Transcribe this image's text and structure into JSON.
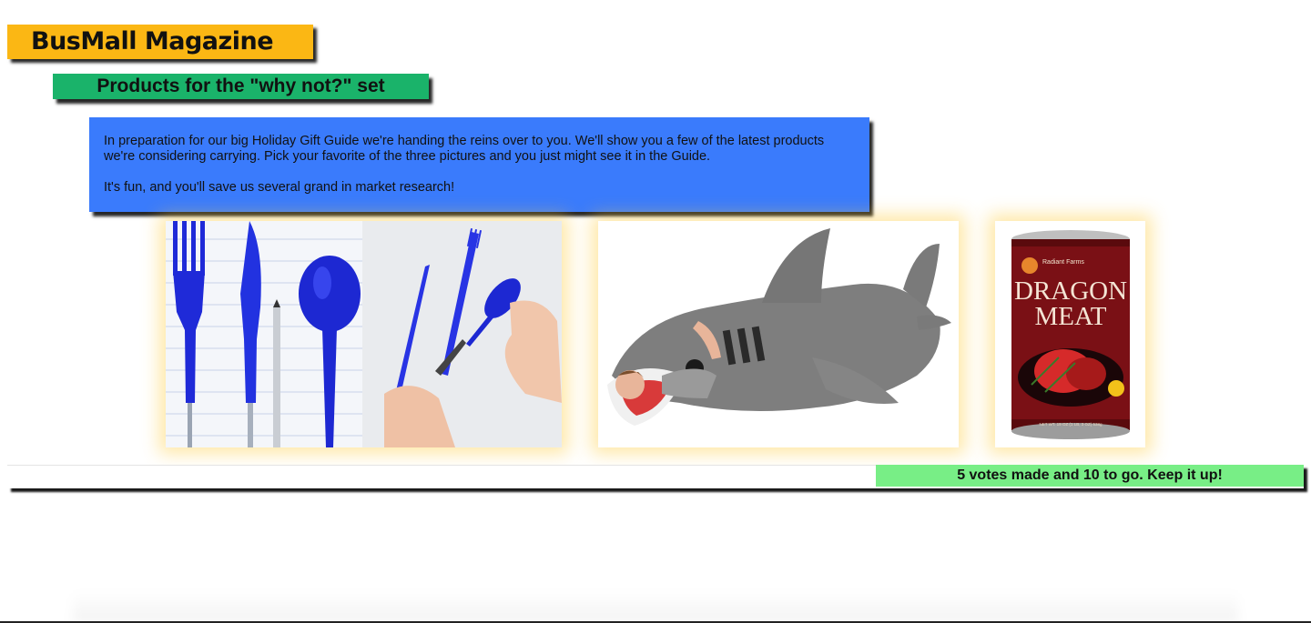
{
  "header": {
    "title": "BusMall Magazine",
    "subtitle": "Products for the \"why not?\" set"
  },
  "intro": {
    "paragraph1": "In preparation for our big Holiday Gift Guide we're handing the reins over to you. We'll show you a few of the latest products we're considering carrying. Pick your favorite of the three pictures and you just might see it in the Guide.",
    "paragraph2": "It's fun, and you'll save us several grand in market research!"
  },
  "products": [
    {
      "name": "pen-utensil-set",
      "image": "blue cutlery pens"
    },
    {
      "name": "shark-sleeping-bag",
      "image": "shark sleeping bag"
    },
    {
      "name": "dragon-meat-can",
      "image": "canned dragon meat",
      "label_brand": "Radiant Farms",
      "label_line1": "DRAGON",
      "label_line2": "MEAT",
      "label_weight": "NET WT. 19 OZ (1 LB, 3 OZ) 538g"
    }
  ],
  "status": {
    "votes_message": "5 votes made and 10 to go. Keep it up!"
  },
  "colors": {
    "title_bg": "#fbb714",
    "subtitle_bg": "#1ab36a",
    "intro_bg": "#3a7bfc",
    "votes_bg": "#78ee86",
    "image_glow": "#ffcd3c"
  }
}
